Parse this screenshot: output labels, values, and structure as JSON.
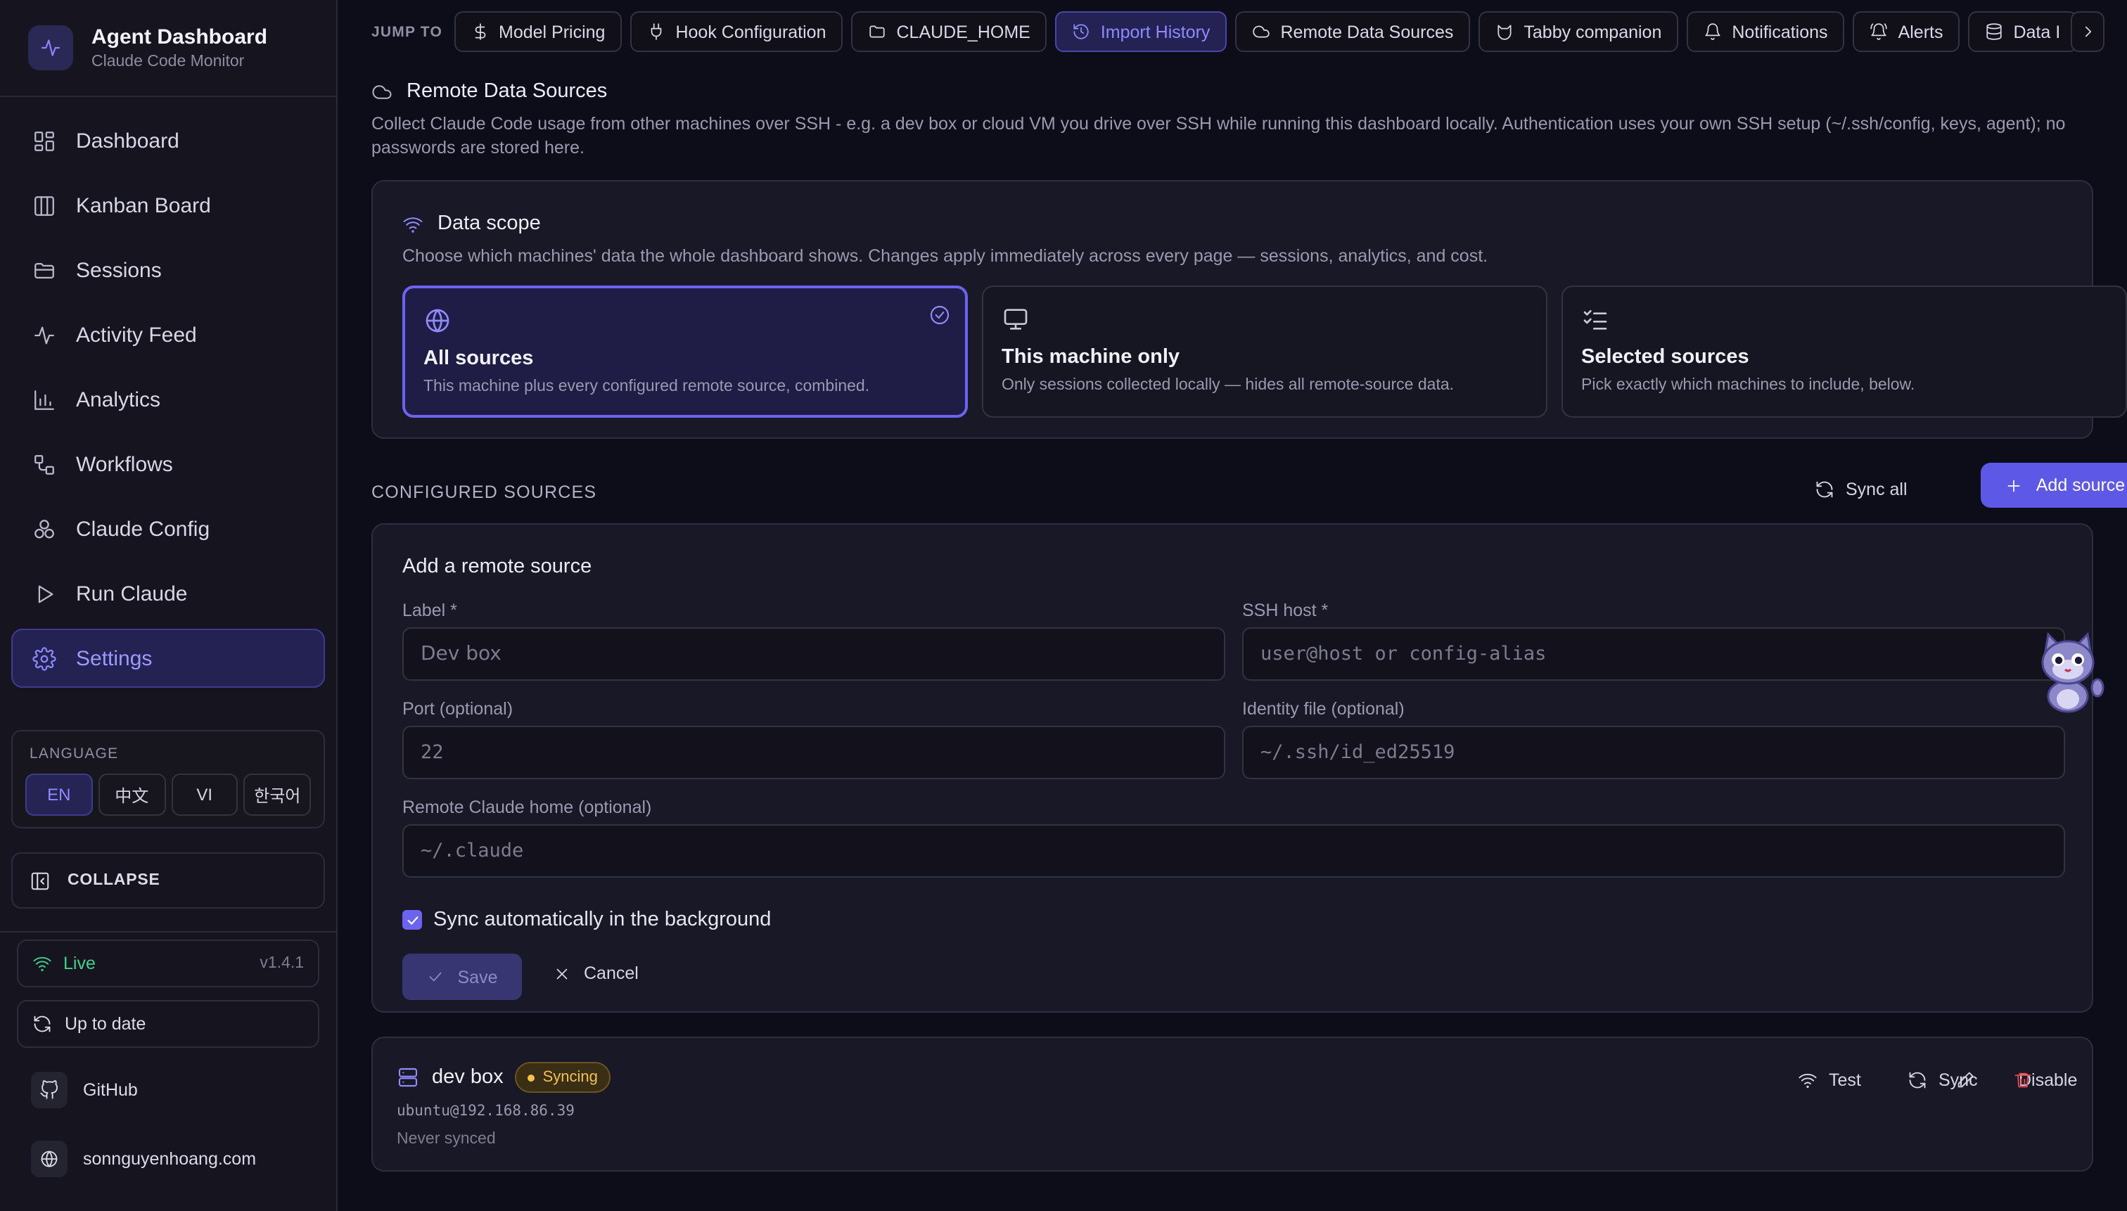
{
  "sidebar": {
    "app_title": "Agent Dashboard",
    "app_subtitle": "Claude Code Monitor",
    "nav": [
      {
        "label": "Dashboard",
        "icon": "dashboard-icon"
      },
      {
        "label": "Kanban Board",
        "icon": "kanban-icon"
      },
      {
        "label": "Sessions",
        "icon": "folder-icon"
      },
      {
        "label": "Activity Feed",
        "icon": "activity-icon"
      },
      {
        "label": "Analytics",
        "icon": "bar-chart-icon"
      },
      {
        "label": "Workflows",
        "icon": "workflow-icon"
      },
      {
        "label": "Claude Config",
        "icon": "config-icon"
      },
      {
        "label": "Run Claude",
        "icon": "play-icon"
      },
      {
        "label": "Settings",
        "icon": "gear-icon",
        "active": true
      }
    ],
    "language": {
      "title": "LANGUAGE",
      "options": [
        "EN",
        "中文",
        "VI",
        "한국어"
      ],
      "selected": "EN"
    },
    "collapse_label": "COLLAPSE",
    "status": {
      "label": "Live",
      "version": "v1.4.1"
    },
    "update_label": "Up to date",
    "links": [
      "GitHub",
      "sonnguyenhoang.com"
    ]
  },
  "jump": {
    "label": "JUMP TO",
    "chips": [
      "Model Pricing",
      "Hook Configuration",
      "CLAUDE_HOME",
      "Import History",
      "Remote Data Sources",
      "Tabby companion",
      "Notifications",
      "Alerts",
      "Data I"
    ],
    "active": "Import History"
  },
  "section": {
    "title": "Remote Data Sources",
    "description": "Collect Claude Code usage from other machines over SSH - e.g. a dev box or cloud VM you drive over SSH while running this dashboard locally. Authentication uses your own SSH setup (~/.ssh/config, keys, agent); no passwords are stored here."
  },
  "scope": {
    "title": "Data scope",
    "description": "Choose which machines' data the whole dashboard shows. Changes apply immediately across every page — sessions, analytics, and cost.",
    "options": [
      {
        "title": "All sources",
        "desc": "This machine plus every configured remote source, combined.",
        "selected": true
      },
      {
        "title": "This machine only",
        "desc": "Only sessions collected locally — hides all remote-source data."
      },
      {
        "title": "Selected sources",
        "desc": "Pick exactly which machines to include, below."
      }
    ]
  },
  "configured": {
    "label": "CONFIGURED SOURCES",
    "sync_all": "Sync all",
    "add_source": "Add source"
  },
  "form": {
    "title": "Add a remote source",
    "label_label": "Label *",
    "label_placeholder": "Dev box",
    "host_label": "SSH host *",
    "host_placeholder": "user@host or config-alias",
    "port_label": "Port (optional)",
    "port_placeholder": "22",
    "identity_label": "Identity file (optional)",
    "identity_placeholder": "~/.ssh/id_ed25519",
    "home_label": "Remote Claude home (optional)",
    "home_placeholder": "~/.claude",
    "auto_sync_label": "Sync automatically in the background",
    "auto_sync_checked": true,
    "save": "Save",
    "cancel": "Cancel"
  },
  "source": {
    "name": "dev box",
    "badge": "Syncing",
    "host": "ubuntu@192.168.86.39",
    "last_sync": "Never synced",
    "actions": {
      "test": "Test",
      "sync": "Sync",
      "disable": "Disable"
    }
  },
  "colors": {
    "accent": "#6a64f0",
    "live": "#3ed18a",
    "syncing": "#f2c34a",
    "danger": "#e5484d"
  }
}
